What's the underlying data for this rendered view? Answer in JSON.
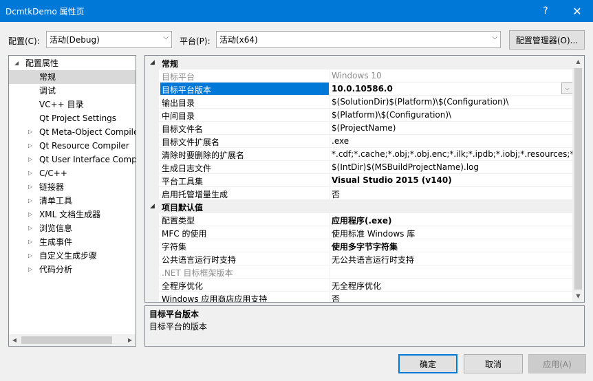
{
  "window": {
    "title": "DcmtkDemo 属性页",
    "help_glyph": "?",
    "close_glyph": "✕"
  },
  "toolbar": {
    "config_label": "配置(C):",
    "config_value": "活动(Debug)",
    "platform_label": "平台(P):",
    "platform_value": "活动(x64)",
    "config_manager_label": "配置管理器(O)..."
  },
  "tree": {
    "root": "配置属性",
    "items": [
      {
        "label": "常规",
        "expandable": false,
        "selected": true
      },
      {
        "label": "调试",
        "expandable": false
      },
      {
        "label": "VC++ 目录",
        "expandable": false
      },
      {
        "label": "Qt Project Settings",
        "expandable": false
      },
      {
        "label": "Qt Meta-Object Compile",
        "expandable": true
      },
      {
        "label": "Qt Resource Compiler",
        "expandable": true
      },
      {
        "label": "Qt User Interface Comp",
        "expandable": true
      },
      {
        "label": "C/C++",
        "expandable": true
      },
      {
        "label": "链接器",
        "expandable": true
      },
      {
        "label": "清单工具",
        "expandable": true
      },
      {
        "label": "XML 文档生成器",
        "expandable": true
      },
      {
        "label": "浏览信息",
        "expandable": true
      },
      {
        "label": "生成事件",
        "expandable": true
      },
      {
        "label": "自定义生成步骤",
        "expandable": true
      },
      {
        "label": "代码分析",
        "expandable": true
      }
    ]
  },
  "grid": {
    "rows": [
      {
        "type": "cat",
        "name": "常规"
      },
      {
        "type": "prop",
        "name": "目标平台",
        "value": "Windows 10",
        "disabled": true
      },
      {
        "type": "prop",
        "name": "目标平台版本",
        "value": "10.0.10586.0",
        "bold": true,
        "selected": true,
        "dropdown": true
      },
      {
        "type": "prop",
        "name": "输出目录",
        "value": "$(SolutionDir)$(Platform)\\$(Configuration)\\"
      },
      {
        "type": "prop",
        "name": "中间目录",
        "value": "$(Platform)\\$(Configuration)\\"
      },
      {
        "type": "prop",
        "name": "目标文件名",
        "value": "$(ProjectName)"
      },
      {
        "type": "prop",
        "name": "目标文件扩展名",
        "value": ".exe"
      },
      {
        "type": "prop",
        "name": "清除时要删除的扩展名",
        "value": "*.cdf;*.cache;*.obj;*.obj.enc;*.ilk;*.ipdb;*.iobj;*.resources;*.tlb;*"
      },
      {
        "type": "prop",
        "name": "生成日志文件",
        "value": "$(IntDir)$(MSBuildProjectName).log"
      },
      {
        "type": "prop",
        "name": "平台工具集",
        "value": "Visual Studio 2015 (v140)",
        "bold": true
      },
      {
        "type": "prop",
        "name": "启用托管增量生成",
        "value": "否"
      },
      {
        "type": "cat",
        "name": "项目默认值"
      },
      {
        "type": "prop",
        "name": "配置类型",
        "value": "应用程序(.exe)",
        "bold": true
      },
      {
        "type": "prop",
        "name": "MFC 的使用",
        "value": "使用标准 Windows 库"
      },
      {
        "type": "prop",
        "name": "字符集",
        "value": "使用多字节字符集",
        "bold": true
      },
      {
        "type": "prop",
        "name": "公共语言运行时支持",
        "value": "无公共语言运行时支持"
      },
      {
        "type": "prop",
        "name": ".NET 目标框架版本",
        "value": "",
        "disabled": true
      },
      {
        "type": "prop",
        "name": "全程序优化",
        "value": "无全程序优化"
      },
      {
        "type": "prop",
        "name": "Windows 应用商店应用支持",
        "value": "否"
      }
    ]
  },
  "description": {
    "title": "目标平台版本",
    "text": "目标平台的版本"
  },
  "buttons": {
    "ok": "确定",
    "cancel": "取消",
    "apply": "应用(A)"
  }
}
